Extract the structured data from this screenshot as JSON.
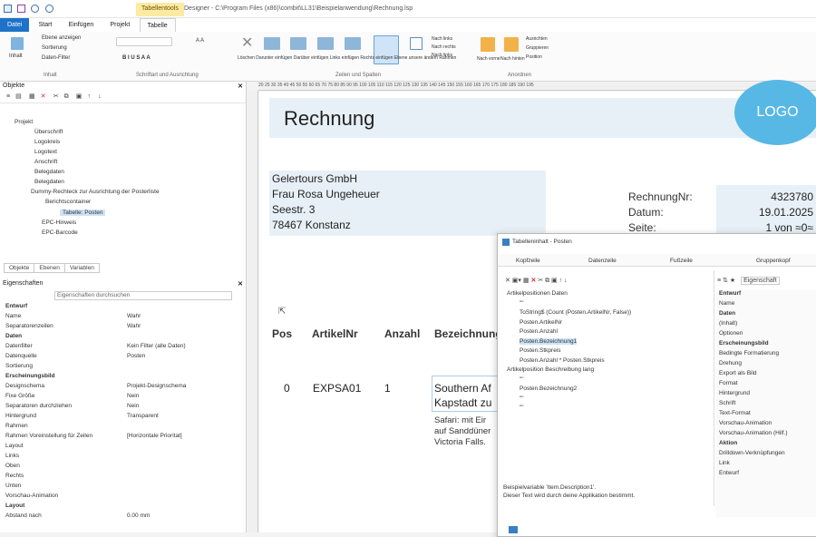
{
  "window": {
    "title": "Designer - C:\\Program Files (x86)\\combit\\LL31\\Beispielanwendung\\Rechnung.lsp",
    "context_tab": "Tabellentools"
  },
  "tabs": [
    "Datei",
    "Start",
    "Einfügen",
    "Projekt",
    "Tabelle"
  ],
  "ribbon": {
    "sort_filter": [
      "Ebene anzeigen",
      "Sortierung",
      "Daten-Filter"
    ],
    "inhalt": "Inhalt",
    "group1": "Inhalt",
    "group2": "Schriftart und Ausrichtung",
    "font_size": "A A",
    "format_buttons": "B I U S A A",
    "rows_group": "Zeilen und Spalten",
    "row_buttons": [
      "Löschen",
      "Darunter einfügen",
      "Darüber einfügen",
      "Links einfügen",
      "Rechts einfügen",
      "Ebene unsere ändern",
      "Rahmen"
    ],
    "rows_right": [
      "Nach links",
      "Nach rechts",
      "Nach links"
    ],
    "anordnen": "Anordnen",
    "anordnen_buttons": [
      "Nach vorne",
      "Nach hinten",
      "Ausrichten",
      "Gruppieren",
      "Position"
    ]
  },
  "objekte": {
    "title": "Objekte",
    "tree": [
      "Projekt",
      "Überschrift",
      "Logokreis",
      "Logotext",
      "Anschrift",
      "Belegdaten",
      "Belegdaten",
      "Dummy-Rechteck zur Ausrichtung der Posterliste",
      "Berichtscontainer",
      "Tabelle: Posten",
      "EPC-Hinweis",
      "EPC-Barcode"
    ],
    "tabs": [
      "Objekte",
      "Ebenen",
      "Variablen"
    ]
  },
  "eigenschaften": {
    "title": "Eigenschaften",
    "search": "Eigenschaften durchsuchen",
    "rows": [
      {
        "k": "Entwurf",
        "v": "",
        "sec": true
      },
      {
        "k": "Name",
        "v": "Wahr"
      },
      {
        "k": "Separatorenzeilen",
        "v": "Wahr"
      },
      {
        "k": "Daten",
        "v": "",
        "sec": true
      },
      {
        "k": "Datenfilter",
        "v": "Kein Filter (alle Daten)"
      },
      {
        "k": "Datenquelle",
        "v": "Posten"
      },
      {
        "k": "Sortierung",
        "v": ""
      },
      {
        "k": "Erscheinungsbild",
        "v": "",
        "sec": true
      },
      {
        "k": "Designschema",
        "v": "Projekt-Designschema"
      },
      {
        "k": "Fixe Größe",
        "v": "Nein"
      },
      {
        "k": "Separatoren durchziehen",
        "v": "Nein"
      },
      {
        "k": "Hintergrund",
        "v": "Transparent"
      },
      {
        "k": "Rahmen",
        "v": ""
      },
      {
        "k": "Rahmen Voreinstellung für Zeilen",
        "v": "[Horizontale Prioritat]"
      },
      {
        "k": "Layout",
        "v": ""
      },
      {
        "k": "Links",
        "v": ""
      },
      {
        "k": "Oben",
        "v": ""
      },
      {
        "k": "Rechts",
        "v": ""
      },
      {
        "k": "Unten",
        "v": ""
      },
      {
        "k": "Vorschau-Animation",
        "v": ""
      },
      {
        "k": "Layout",
        "v": "",
        "sec": true
      },
      {
        "k": "Abstand nach",
        "v": "0.00 mm"
      }
    ]
  },
  "ruler": "20 25 30 35 40 45 50 55 60 65 70 75 80 85 90 95 100 105 110 115 120 125 130 135 140 145 150 155 160 165 170 175 180 185 190 195",
  "page": {
    "title": "Rechnung",
    "logo": "LOGO",
    "address": [
      "Gelertours GmbH",
      "Frau Rosa Ungeheuer",
      "Seestr. 3",
      "78467 Konstanz"
    ],
    "meta": [
      {
        "k": "RechnungNr:",
        "v": "4323780"
      },
      {
        "k": "Datum:",
        "v": "19.01.2025"
      },
      {
        "k": "Seite:",
        "v": "1 von ≈0≈"
      }
    ],
    "headers": [
      "Pos",
      "ArtikelNr",
      "Anzahl",
      "Bezeichnung"
    ],
    "row": {
      "pos": "0",
      "artnr": "EXPSA01",
      "anzahl": "1",
      "bez1": "Southern Af",
      "bez2": "Kapstadt zu"
    },
    "desc": [
      "Safari: mit Eir",
      "auf Sanddüner",
      "Victoria Falls."
    ]
  },
  "dialog": {
    "title": "Tabelleninhalt - Posten",
    "tabs": [
      "Kopfzeile",
      "Datenzeile",
      "Fußzeile",
      "Gruppenkopf"
    ],
    "tree": [
      "Artikelpositionen Daten",
      "\"\"",
      "ToString$ (Count (Posten.ArtikelNr, False))",
      "Posten.ArtikelNr",
      "Posten.Anzahl",
      "Posten.Bezeichnung1",
      "Posten.Stkpreis",
      "Posten.Anzahl * Posten.Stkpreis",
      "Artikelposition Beschreibung lang",
      "\"\"",
      "Posten.Bezeichnung2",
      "\"\"",
      "\"\""
    ],
    "props": [
      "Entwurf",
      "Name",
      "Daten",
      "(Inhalt)",
      "Optionen",
      "Erscheinungsbild",
      "Bedingte Formatierung",
      "Drehung",
      "Export als Bild",
      "Format",
      "Hintergrund",
      "Schrift",
      "Text-Format",
      "Vorschau-Animation",
      "Vorschau-Animation (Hilf.)",
      "Aktion",
      "Drilldown-Verknüpfungen",
      "Link",
      "Entwurf"
    ],
    "search": "Eigenschaft",
    "footer": [
      "Beispielvariable 'Item.Description1'.",
      "Dieser Text wird durch deine Applikation bestimmt."
    ]
  }
}
